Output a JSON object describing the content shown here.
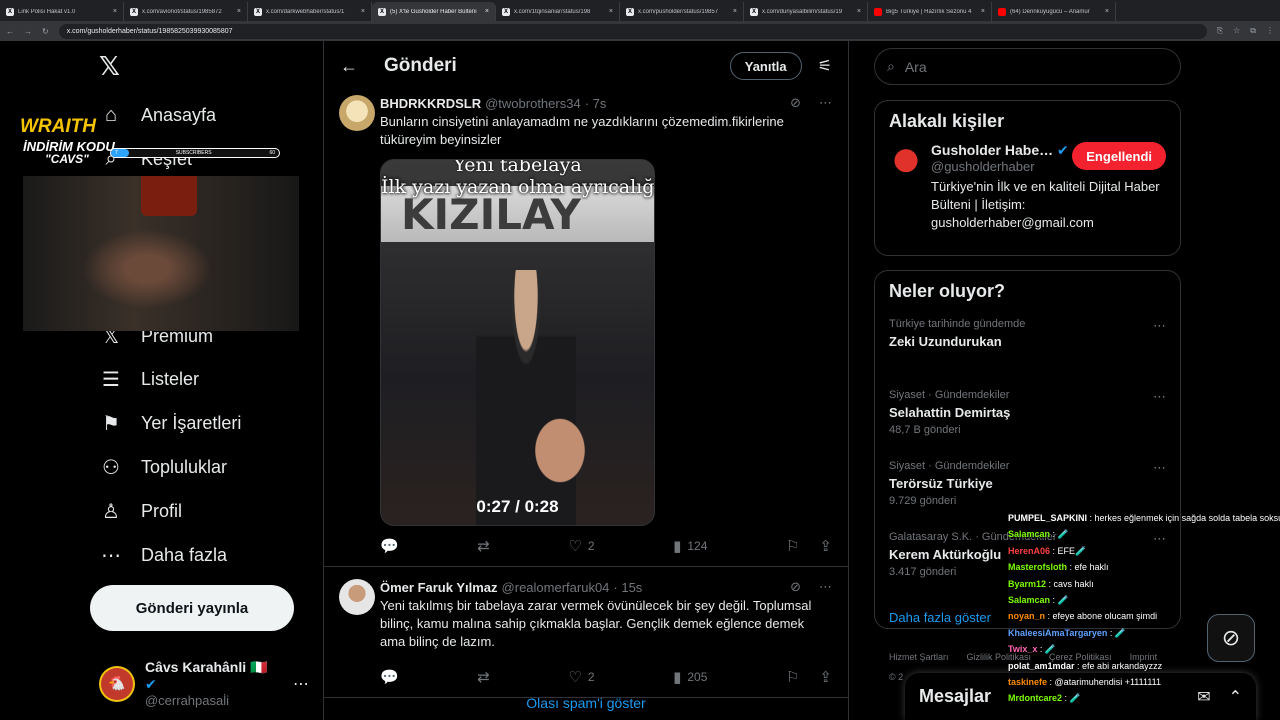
{
  "browser": {
    "tabs": [
      {
        "title": "Link Polisi Hakat v1.0",
        "icon": "globe-icon",
        "yt": false
      },
      {
        "title": "x.com/avionot/status/1985872",
        "icon": "x-icon",
        "yt": false
      },
      {
        "title": "x.com/darkwebhaber/status/1",
        "icon": "x-icon",
        "yt": false
      },
      {
        "title": "(5) X'te Gusholder Haber Bülteni",
        "icon": "x-icon",
        "yt": false,
        "active": true
      },
      {
        "title": "x.com/1tqinsaniar/status/198",
        "icon": "x-icon",
        "yt": false
      },
      {
        "title": "x.com/pusholder/status/19857",
        "icon": "x-icon",
        "yt": false
      },
      {
        "title": "x.com/dunyasalbilim/status/19",
        "icon": "x-icon",
        "yt": false
      },
      {
        "title": "Big5 Türkiye | Hazırlık Sezonu 4",
        "icon": "youtube-icon",
        "yt": true
      },
      {
        "title": "(64) Derinkuyugücü – Anamur",
        "icon": "youtube-icon",
        "yt": true
      }
    ],
    "url": "x.com/gusholderhaber/status/1985825039930085807"
  },
  "sidebar": {
    "logo": "𝕏",
    "items": [
      {
        "label": "Anasayfa",
        "icon": "⌂",
        "top": 0
      },
      {
        "label": "Keşfet",
        "icon": "⌕",
        "top": 0
      },
      {
        "label": "Premium",
        "icon": "𝕏",
        "top": 0
      },
      {
        "label": "Listeler",
        "icon": "☰",
        "top": 0
      },
      {
        "label": "Yer İşaretleri",
        "icon": "⚑",
        "top": 0
      },
      {
        "label": "Topluluklar",
        "icon": "⚇",
        "top": 0
      },
      {
        "label": "Profil",
        "icon": "♙",
        "top": 0
      },
      {
        "label": "Daha fazla",
        "icon": "⋯",
        "top": 0
      }
    ],
    "post_button": "Gönderi yayınla",
    "profile": {
      "name": "Câvs Karahânli 🇮🇹",
      "handle": "@cerrahpasal̇i",
      "verified": "✔"
    }
  },
  "overlay": {
    "brand": "WRAITH",
    "line2": "İNDİRİM KODU",
    "line3": "\"CAVS\"",
    "sub_label": "SUBSCRIBERS",
    "sub_left": "7",
    "sub_count": "60"
  },
  "main": {
    "title": "Gönderi",
    "reply_button": "Yanıtla",
    "tweets": [
      {
        "name": "BHDRKKRDSLR",
        "handle": "@twobrothers34",
        "time": "· 7s",
        "text": "Bunların cinsiyetini anlayamadım ne yazdıklarını çözemedim.fikirlerine tüküreyim beyinsizler",
        "media": {
          "caption1": "Yeni tabelaya",
          "caption2": "İlk yazı yazan olma ayrıcalığı",
          "sign": "KIZILAY",
          "duration": "0:27 / 0:28"
        },
        "likes": "2",
        "views": "124"
      },
      {
        "name": "Ömer Faruk Yılmaz",
        "handle": "@realomerfaruk04",
        "time": "· 15s",
        "text": "Yeni takılmış bir tabelaya zarar vermek övünülecek bir şey değil. Toplumsal bilinç, kamu malına sahip çıkmakla başlar. Gençlik demek eğlence demek ama bilinç de lazım.",
        "likes": "2",
        "views": "205"
      }
    ],
    "show_spam": "Olası spam'i göster"
  },
  "right": {
    "search_placeholder": "Ara",
    "related_title": "Alakalı kişiler",
    "related": {
      "name": "Gusholder Habe…",
      "handle": "@gusholderhaber",
      "button": "Engellendi",
      "bio": "Türkiye'nin İlk ve en kaliteli Dijital Haber Bülteni | İletişim: gusholderhaber@gmail.com"
    },
    "trends_title": "Neler oluyor?",
    "trends": [
      {
        "cat": "Türkiye tarihinde gündemde",
        "name": "Zeki Uzundurukan",
        "count": ""
      },
      {
        "cat": "Siyaset · Gündemdekiler",
        "name": "Selahattin Demirtaş",
        "count": "48,7 B gönderi"
      },
      {
        "cat": "Siyaset · Gündemdekiler",
        "name": "Terörsüz Türkiye",
        "count": "9.729 gönderi"
      },
      {
        "cat": "Galatasaray S.K. · Gündemdekiler",
        "name": "Kerem Aktürkoğlu",
        "count": "3.417 gönderi"
      }
    ],
    "show_more": "Daha fazla göster",
    "footer": [
      "Hizmet Şartları",
      "Gizlilik Politikası",
      "Çerez Politikası",
      "Imprint",
      "© 2"
    ],
    "messages": "Mesajlar"
  },
  "chat": [
    {
      "user": "PUMPEL_SAPKINI",
      "color": "#ffffff",
      "msg": ": herkes eğlenmek için sağda solda tabela soksun o zaman"
    },
    {
      "user": "Salamcan",
      "color": "#7cfc00",
      "msg": ": 🧪"
    },
    {
      "user": "HerenA06",
      "color": "#ff4040",
      "msg": ": EFE🧪"
    },
    {
      "user": "Masterofsloth",
      "color": "#7cfc00",
      "msg": ": efe haklı"
    },
    {
      "user": "Byarm12",
      "color": "#7cfc00",
      "msg": ": cavs haklı"
    },
    {
      "user": "Salamcan",
      "color": "#7cfc00",
      "msg": ": 🧪"
    },
    {
      "user": "noyan_n",
      "color": "#ff8c00",
      "msg": ": efeye abone olucam şimdi"
    },
    {
      "user": "KhaleesiAmaTargaryen",
      "color": "#5ea1ff",
      "msg": ": 🧪"
    },
    {
      "user": "Twix_x",
      "color": "#ff69b4",
      "msg": ": 🧪"
    },
    {
      "user": "polat_am1mdar",
      "color": "#ffffff",
      "msg": ": efe abi arkandayzzz"
    },
    {
      "user": "taskinefe",
      "color": "#ff8c00",
      "msg": ": @atarimuhendisi +1111111"
    },
    {
      "user": "Mrdontcare2",
      "color": "#7cfc00",
      "msg": ": 🧪"
    }
  ],
  "colors": {
    "accent": "#1d9bf0",
    "blocked": "#f4212e",
    "wraith": "#f5c400"
  }
}
